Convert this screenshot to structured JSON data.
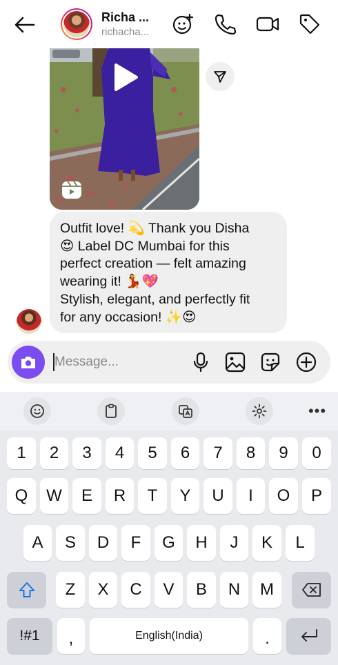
{
  "header": {
    "name": "Richa ...",
    "username": "richacha...",
    "icons": [
      "back-arrow-icon",
      "effects-icon",
      "phone-icon",
      "video-icon",
      "tag-icon"
    ]
  },
  "chat": {
    "media": {
      "type": "reel",
      "icons": [
        "play-icon",
        "reels-icon",
        "share-icon"
      ]
    },
    "message_lines": [
      "Outfit love! 💫 Thank you Disha",
      "😍 Label DC Mumbai  for this",
      "perfect creation — felt amazing",
      "wearing it! 💃💖",
      "Stylish, elegant, and perfectly fit",
      "for any occasion! ✨😍"
    ]
  },
  "composer": {
    "placeholder": "Message...",
    "accent_color": "#7b4cf0",
    "icons": [
      "camera-icon",
      "microphone-icon",
      "gallery-icon",
      "sticker-icon",
      "add-icon"
    ]
  },
  "keyboard": {
    "toolbar_icons": [
      "emoji-icon",
      "clipboard-icon",
      "translate-icon",
      "settings-icon"
    ],
    "more_label": "•••",
    "number_row": [
      "1",
      "2",
      "3",
      "4",
      "5",
      "6",
      "7",
      "8",
      "9",
      "0"
    ],
    "row1": [
      "Q",
      "W",
      "E",
      "R",
      "T",
      "Y",
      "U",
      "I",
      "O",
      "P"
    ],
    "row2": [
      "A",
      "S",
      "D",
      "F",
      "G",
      "H",
      "J",
      "K",
      "L"
    ],
    "row3": [
      "Z",
      "X",
      "C",
      "V",
      "B",
      "N",
      "M"
    ],
    "symbols_label": "!#1",
    "comma_label": ",",
    "space_label": "English(India)",
    "period_label": ".",
    "shift_color": "#1a73e8"
  }
}
